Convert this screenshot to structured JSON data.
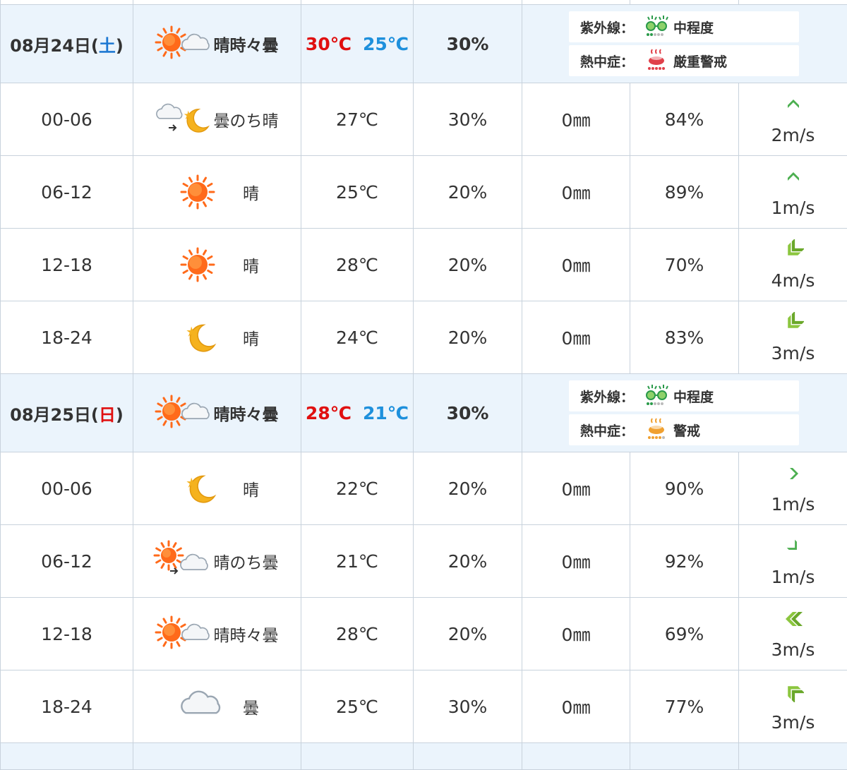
{
  "days": [
    {
      "date": "08月24日",
      "weekday": "土",
      "weekday_type": "sat",
      "weather": "晴時々曇",
      "weather_icon": "sun-cloud-icon",
      "temp_max": "30℃",
      "temp_min": "25℃",
      "precip_prob": "30%",
      "uv_label": "紫外線：",
      "uv_value": "中程度",
      "heat_label": "熱中症：",
      "heat_value": "厳重警戒",
      "heat_color": "#e0404a",
      "hours": [
        {
          "time": "00-06",
          "weather": "曇のち晴",
          "icon": "cloud-to-moon-icon",
          "temp": "27℃",
          "prob": "30%",
          "rain": "0㎜",
          "humidity": "84%",
          "wind": "2m/s",
          "wind_icon": "wind-n-icon"
        },
        {
          "time": "06-12",
          "weather": "晴",
          "icon": "sun-icon",
          "temp": "25℃",
          "prob": "20%",
          "rain": "0㎜",
          "humidity": "89%",
          "wind": "1m/s",
          "wind_icon": "wind-n-icon"
        },
        {
          "time": "12-18",
          "weather": "晴",
          "icon": "sun-icon",
          "temp": "28℃",
          "prob": "20%",
          "rain": "0㎜",
          "humidity": "70%",
          "wind": "4m/s",
          "wind_icon": "wind-sw-icon"
        },
        {
          "time": "18-24",
          "weather": "晴",
          "icon": "moon-icon",
          "temp": "24℃",
          "prob": "20%",
          "rain": "0㎜",
          "humidity": "83%",
          "wind": "3m/s",
          "wind_icon": "wind-sw-icon"
        }
      ]
    },
    {
      "date": "08月25日",
      "weekday": "日",
      "weekday_type": "sun",
      "weather": "晴時々曇",
      "weather_icon": "sun-cloud-icon",
      "temp_max": "28℃",
      "temp_min": "21℃",
      "precip_prob": "30%",
      "uv_label": "紫外線：",
      "uv_value": "中程度",
      "heat_label": "熱中症：",
      "heat_value": "警戒",
      "heat_color": "#f0a030",
      "hours": [
        {
          "time": "00-06",
          "weather": "晴",
          "icon": "moon-icon",
          "temp": "22℃",
          "prob": "20%",
          "rain": "0㎜",
          "humidity": "90%",
          "wind": "1m/s",
          "wind_icon": "wind-e-icon"
        },
        {
          "time": "06-12",
          "weather": "晴のち曇",
          "icon": "sun-to-cloud-icon",
          "temp": "21℃",
          "prob": "20%",
          "rain": "0㎜",
          "humidity": "92%",
          "wind": "1m/s",
          "wind_icon": "wind-se-icon"
        },
        {
          "time": "12-18",
          "weather": "晴時々曇",
          "icon": "sun-cloud-icon",
          "temp": "28℃",
          "prob": "20%",
          "rain": "0㎜",
          "humidity": "69%",
          "wind": "3m/s",
          "wind_icon": "wind-w-icon"
        },
        {
          "time": "18-24",
          "weather": "曇",
          "icon": "cloud-icon",
          "temp": "25℃",
          "prob": "30%",
          "rain": "0㎜",
          "humidity": "77%",
          "wind": "3m/s",
          "wind_icon": "wind-nw-icon"
        }
      ]
    }
  ]
}
